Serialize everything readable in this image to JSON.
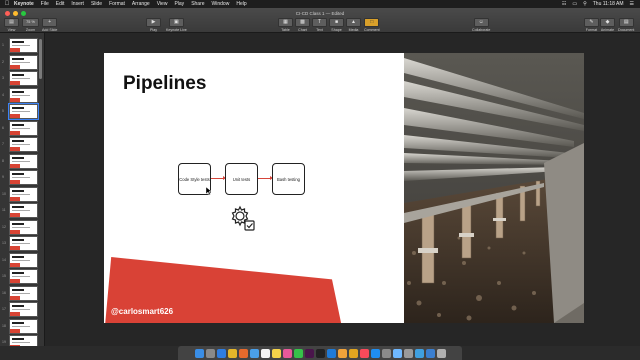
{
  "menubar": {
    "apple": "",
    "items": [
      "Keynote",
      "File",
      "Edit",
      "Insert",
      "Slide",
      "Format",
      "Arrange",
      "View",
      "Play",
      "Share",
      "Window",
      "Help"
    ],
    "clock": "Thu 11:18 AM"
  },
  "window": {
    "title": "CI-CD Class 1 — Edited"
  },
  "toolbar": {
    "view_label": "View",
    "zoom_label": "Zoom",
    "zoom_value": "75 %",
    "add_slide_label": "Add Slide",
    "play_label": "Play",
    "keynote_live_label": "Keynote Live",
    "table_label": "Table",
    "chart_label": "Chart",
    "text_label": "Text",
    "shape_label": "Shape",
    "media_label": "Media",
    "comment_label": "Comment",
    "collaborate_label": "Collaborate",
    "format_label": "Format",
    "animate_label": "Animate",
    "document_label": "Document"
  },
  "navigator": {
    "slide_numbers": [
      "1",
      "2",
      "3",
      "4",
      "5",
      "6",
      "7",
      "8",
      "9",
      "10",
      "11",
      "12",
      "13",
      "14",
      "15",
      "16",
      "17",
      "18",
      "19"
    ],
    "selected_index": 4
  },
  "slide": {
    "title": "Pipelines",
    "pipeline_steps": [
      "Code Style tests",
      "Unit tests",
      "Bash testing"
    ],
    "handle": "@carlosmart626",
    "accent_color": "#d94236"
  },
  "dock": {
    "icons": [
      "finder-icon",
      "launchpad-icon",
      "safari-icon",
      "chrome-icon",
      "firefox-icon",
      "mail-icon",
      "calendar-icon",
      "notes-icon",
      "photos-icon",
      "messages-icon",
      "slack-icon",
      "terminal-icon",
      "vscode-icon",
      "sketch-icon",
      "keynote-icon",
      "music-icon",
      "app-store-icon",
      "settings-icon",
      "preview-icon",
      "screenshot-icon",
      "folder-icon",
      "downloads-icon",
      "trash-icon"
    ]
  }
}
